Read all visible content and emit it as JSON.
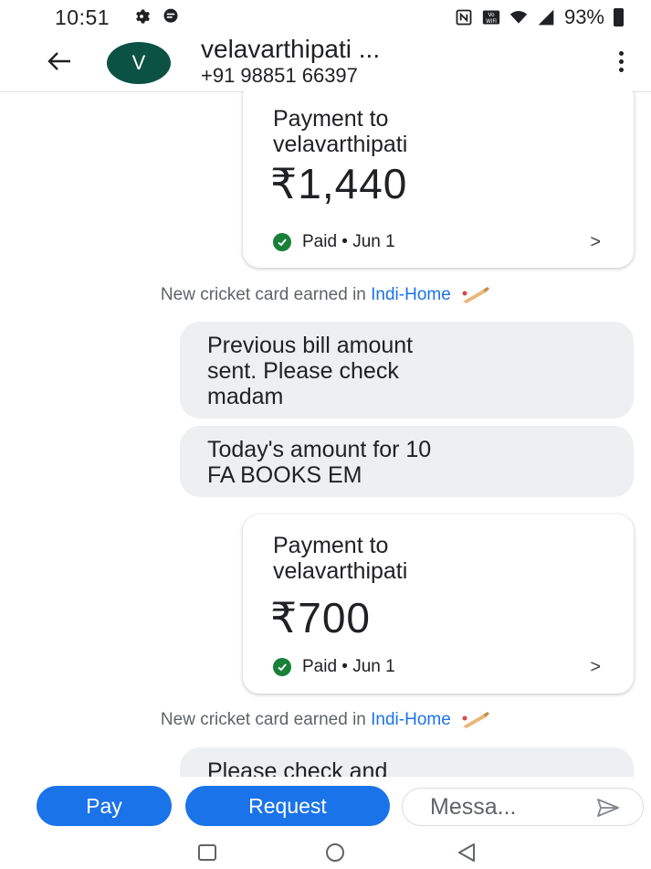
{
  "status_bar": {
    "time": "10:51",
    "battery": "93%"
  },
  "header": {
    "avatar_letter": "V",
    "contact_name": "velavarthipati ...",
    "contact_phone": "+91 98851 66397"
  },
  "messages": {
    "payment_1": {
      "label_line1": "Payment to",
      "label_line2": "velavarthipati",
      "amount": "₹1,440",
      "status": "Paid • Jun 1"
    },
    "system_1": {
      "text": "New cricket card earned in ",
      "link": "Indi-Home"
    },
    "bubble_1": {
      "line1": "Previous bill amount",
      "line2": "sent. Please check",
      "line3": "madam"
    },
    "bubble_2": {
      "line1": "Today's amount  for 10",
      "line2": "FA BOOKS EM"
    },
    "payment_2": {
      "label_line1": "Payment to",
      "label_line2": "velavarthipati",
      "amount": "₹700",
      "status": "Paid • Jun 1"
    },
    "system_2": {
      "text": "New cricket card earned in ",
      "link": "Indi-Home"
    },
    "bubble_3": {
      "line1": "Please check and"
    }
  },
  "bottom_bar": {
    "pay_label": "Pay",
    "request_label": "Request",
    "message_placeholder": "Messa..."
  },
  "colors": {
    "accent": "#1a73e8",
    "avatar_bg": "#0b5244",
    "paid_green": "#188038",
    "bubble_bg": "#eeeff1"
  },
  "icons": {
    "status": [
      "settings-gear-icon",
      "chat-notification-icon",
      "nfc-icon",
      "vowifi-icon",
      "wifi-icon",
      "signal-icon",
      "battery-icon"
    ],
    "header": [
      "back-arrow-icon",
      "more-vert-icon"
    ],
    "cards": [
      "check-circle-icon",
      "chevron-right-icon",
      "cricket-bat-icon"
    ],
    "composer": [
      "send-icon"
    ],
    "nav": [
      "recents-icon",
      "home-icon",
      "back-icon"
    ]
  }
}
